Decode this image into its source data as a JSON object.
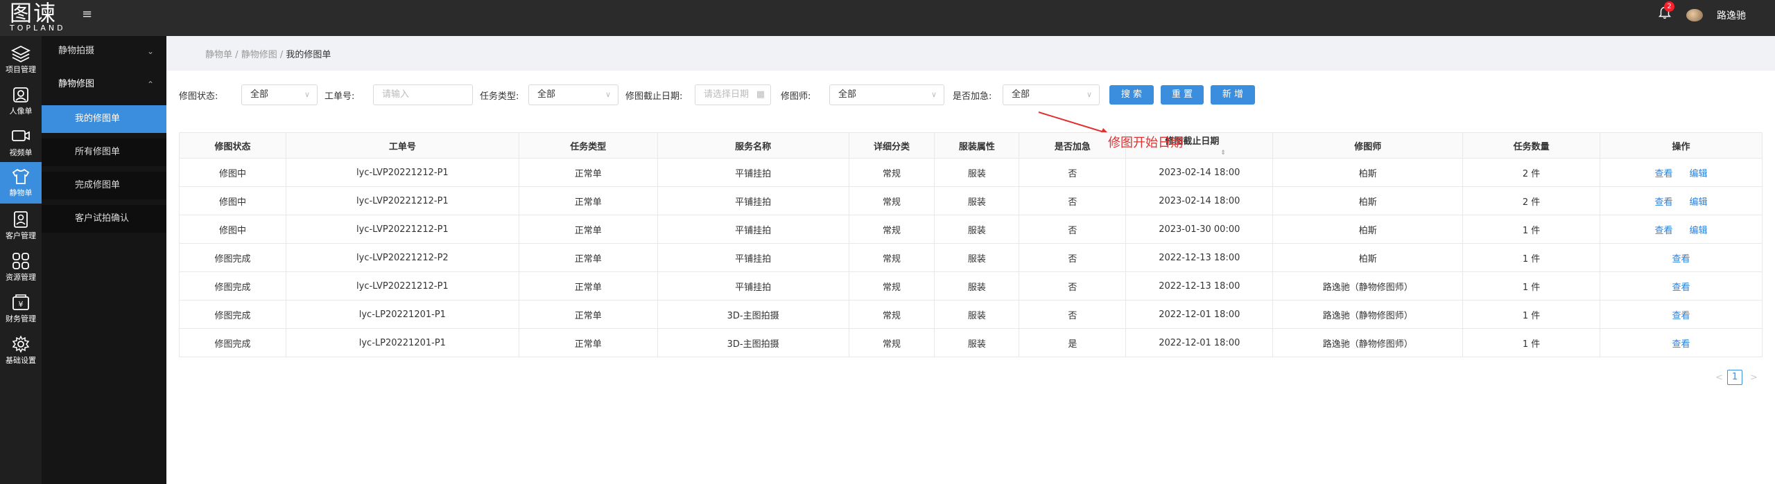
{
  "header": {
    "logo_cn": "图谏",
    "logo_en": "TOPLAND",
    "notification_count": "2",
    "username": "路逸驰"
  },
  "sidebar": {
    "items": [
      {
        "label": "项目管理",
        "icon": "layers-icon"
      },
      {
        "label": "人像单",
        "icon": "portrait-icon"
      },
      {
        "label": "视频单",
        "icon": "video-icon"
      },
      {
        "label": "静物单",
        "icon": "shirt-icon"
      },
      {
        "label": "客户管理",
        "icon": "contact-card-icon"
      },
      {
        "label": "资源管理",
        "icon": "grid-icon"
      },
      {
        "label": "财务管理",
        "icon": "finance-icon"
      },
      {
        "label": "基础设置",
        "icon": "gear-icon"
      }
    ],
    "active_index": 3
  },
  "submenu": {
    "group1": "静物拍摄",
    "group2": "静物修图",
    "items": [
      "我的修图单",
      "所有修图单",
      "完成修图单",
      "客户试拍确认"
    ]
  },
  "breadcrumb": {
    "part1": "静物单",
    "part2": "静物修图",
    "current": "我的修图单",
    "sep": "/"
  },
  "filters": {
    "status_label": "修图状态:",
    "status_value": "全部",
    "order_no_label": "工单号:",
    "order_no_placeholder": "请输入",
    "task_type_label": "任务类型:",
    "task_type_value": "全部",
    "deadline_label": "修图截止日期:",
    "deadline_placeholder": "请选择日期",
    "retoucher_label": "修图师:",
    "retoucher_value": "全部",
    "urgent_label": "是否加急:",
    "urgent_value": "全部",
    "search_btn": "搜 索",
    "reset_btn": "重 置",
    "add_btn": "新 增"
  },
  "annotation": {
    "text": "修图开始日期",
    "color": "#e03030"
  },
  "table": {
    "headers": [
      "修图状态",
      "工单号",
      "任务类型",
      "服务名称",
      "详细分类",
      "服装属性",
      "是否加急",
      "修图截止日期",
      "修图师",
      "任务数量",
      "操作"
    ],
    "rows": [
      {
        "status": "修图中",
        "order": "lyc-LVP20221212-P1",
        "type": "正常单",
        "service": "平铺挂拍",
        "category": "常规",
        "attr": "服装",
        "urgent": "否",
        "deadline": "2023-02-14 18:00",
        "retoucher": "柏斯",
        "qty": "2 件",
        "actions": [
          "查看",
          "编辑"
        ]
      },
      {
        "status": "修图中",
        "order": "lyc-LVP20221212-P1",
        "type": "正常单",
        "service": "平铺挂拍",
        "category": "常规",
        "attr": "服装",
        "urgent": "否",
        "deadline": "2023-02-14 18:00",
        "retoucher": "柏斯",
        "qty": "2 件",
        "actions": [
          "查看",
          "编辑"
        ]
      },
      {
        "status": "修图中",
        "order": "lyc-LVP20221212-P1",
        "type": "正常单",
        "service": "平铺挂拍",
        "category": "常规",
        "attr": "服装",
        "urgent": "否",
        "deadline": "2023-01-30 00:00",
        "retoucher": "柏斯",
        "qty": "1 件",
        "actions": [
          "查看",
          "编辑"
        ]
      },
      {
        "status": "修图完成",
        "order": "lyc-LVP20221212-P2",
        "type": "正常单",
        "service": "平铺挂拍",
        "category": "常规",
        "attr": "服装",
        "urgent": "否",
        "deadline": "2022-12-13 18:00",
        "retoucher": "柏斯",
        "qty": "1 件",
        "actions": [
          "查看"
        ]
      },
      {
        "status": "修图完成",
        "order": "lyc-LVP20221212-P1",
        "type": "正常单",
        "service": "平铺挂拍",
        "category": "常规",
        "attr": "服装",
        "urgent": "否",
        "deadline": "2022-12-13 18:00",
        "retoucher": "路逸驰（静物修图师）",
        "qty": "1 件",
        "actions": [
          "查看"
        ]
      },
      {
        "status": "修图完成",
        "order": "lyc-LP20221201-P1",
        "type": "正常单",
        "service": "3D-主图拍摄",
        "category": "常规",
        "attr": "服装",
        "urgent": "否",
        "deadline": "2022-12-01 18:00",
        "retoucher": "路逸驰（静物修图师）",
        "qty": "1 件",
        "actions": [
          "查看"
        ]
      },
      {
        "status": "修图完成",
        "order": "lyc-LP20221201-P1",
        "type": "正常单",
        "service": "3D-主图拍摄",
        "category": "常规",
        "attr": "服装",
        "urgent": "是",
        "deadline": "2022-12-01 18:00",
        "retoucher": "路逸驰（静物修图师）",
        "qty": "1 件",
        "actions": [
          "查看"
        ]
      }
    ]
  },
  "pagination": {
    "prev": "<",
    "next": ">",
    "current": "1"
  },
  "colors": {
    "accent": "#3b8ede",
    "link": "#2d7fd8",
    "topbar": "#2b2b2b",
    "sidebar": "#1f1f1f"
  }
}
